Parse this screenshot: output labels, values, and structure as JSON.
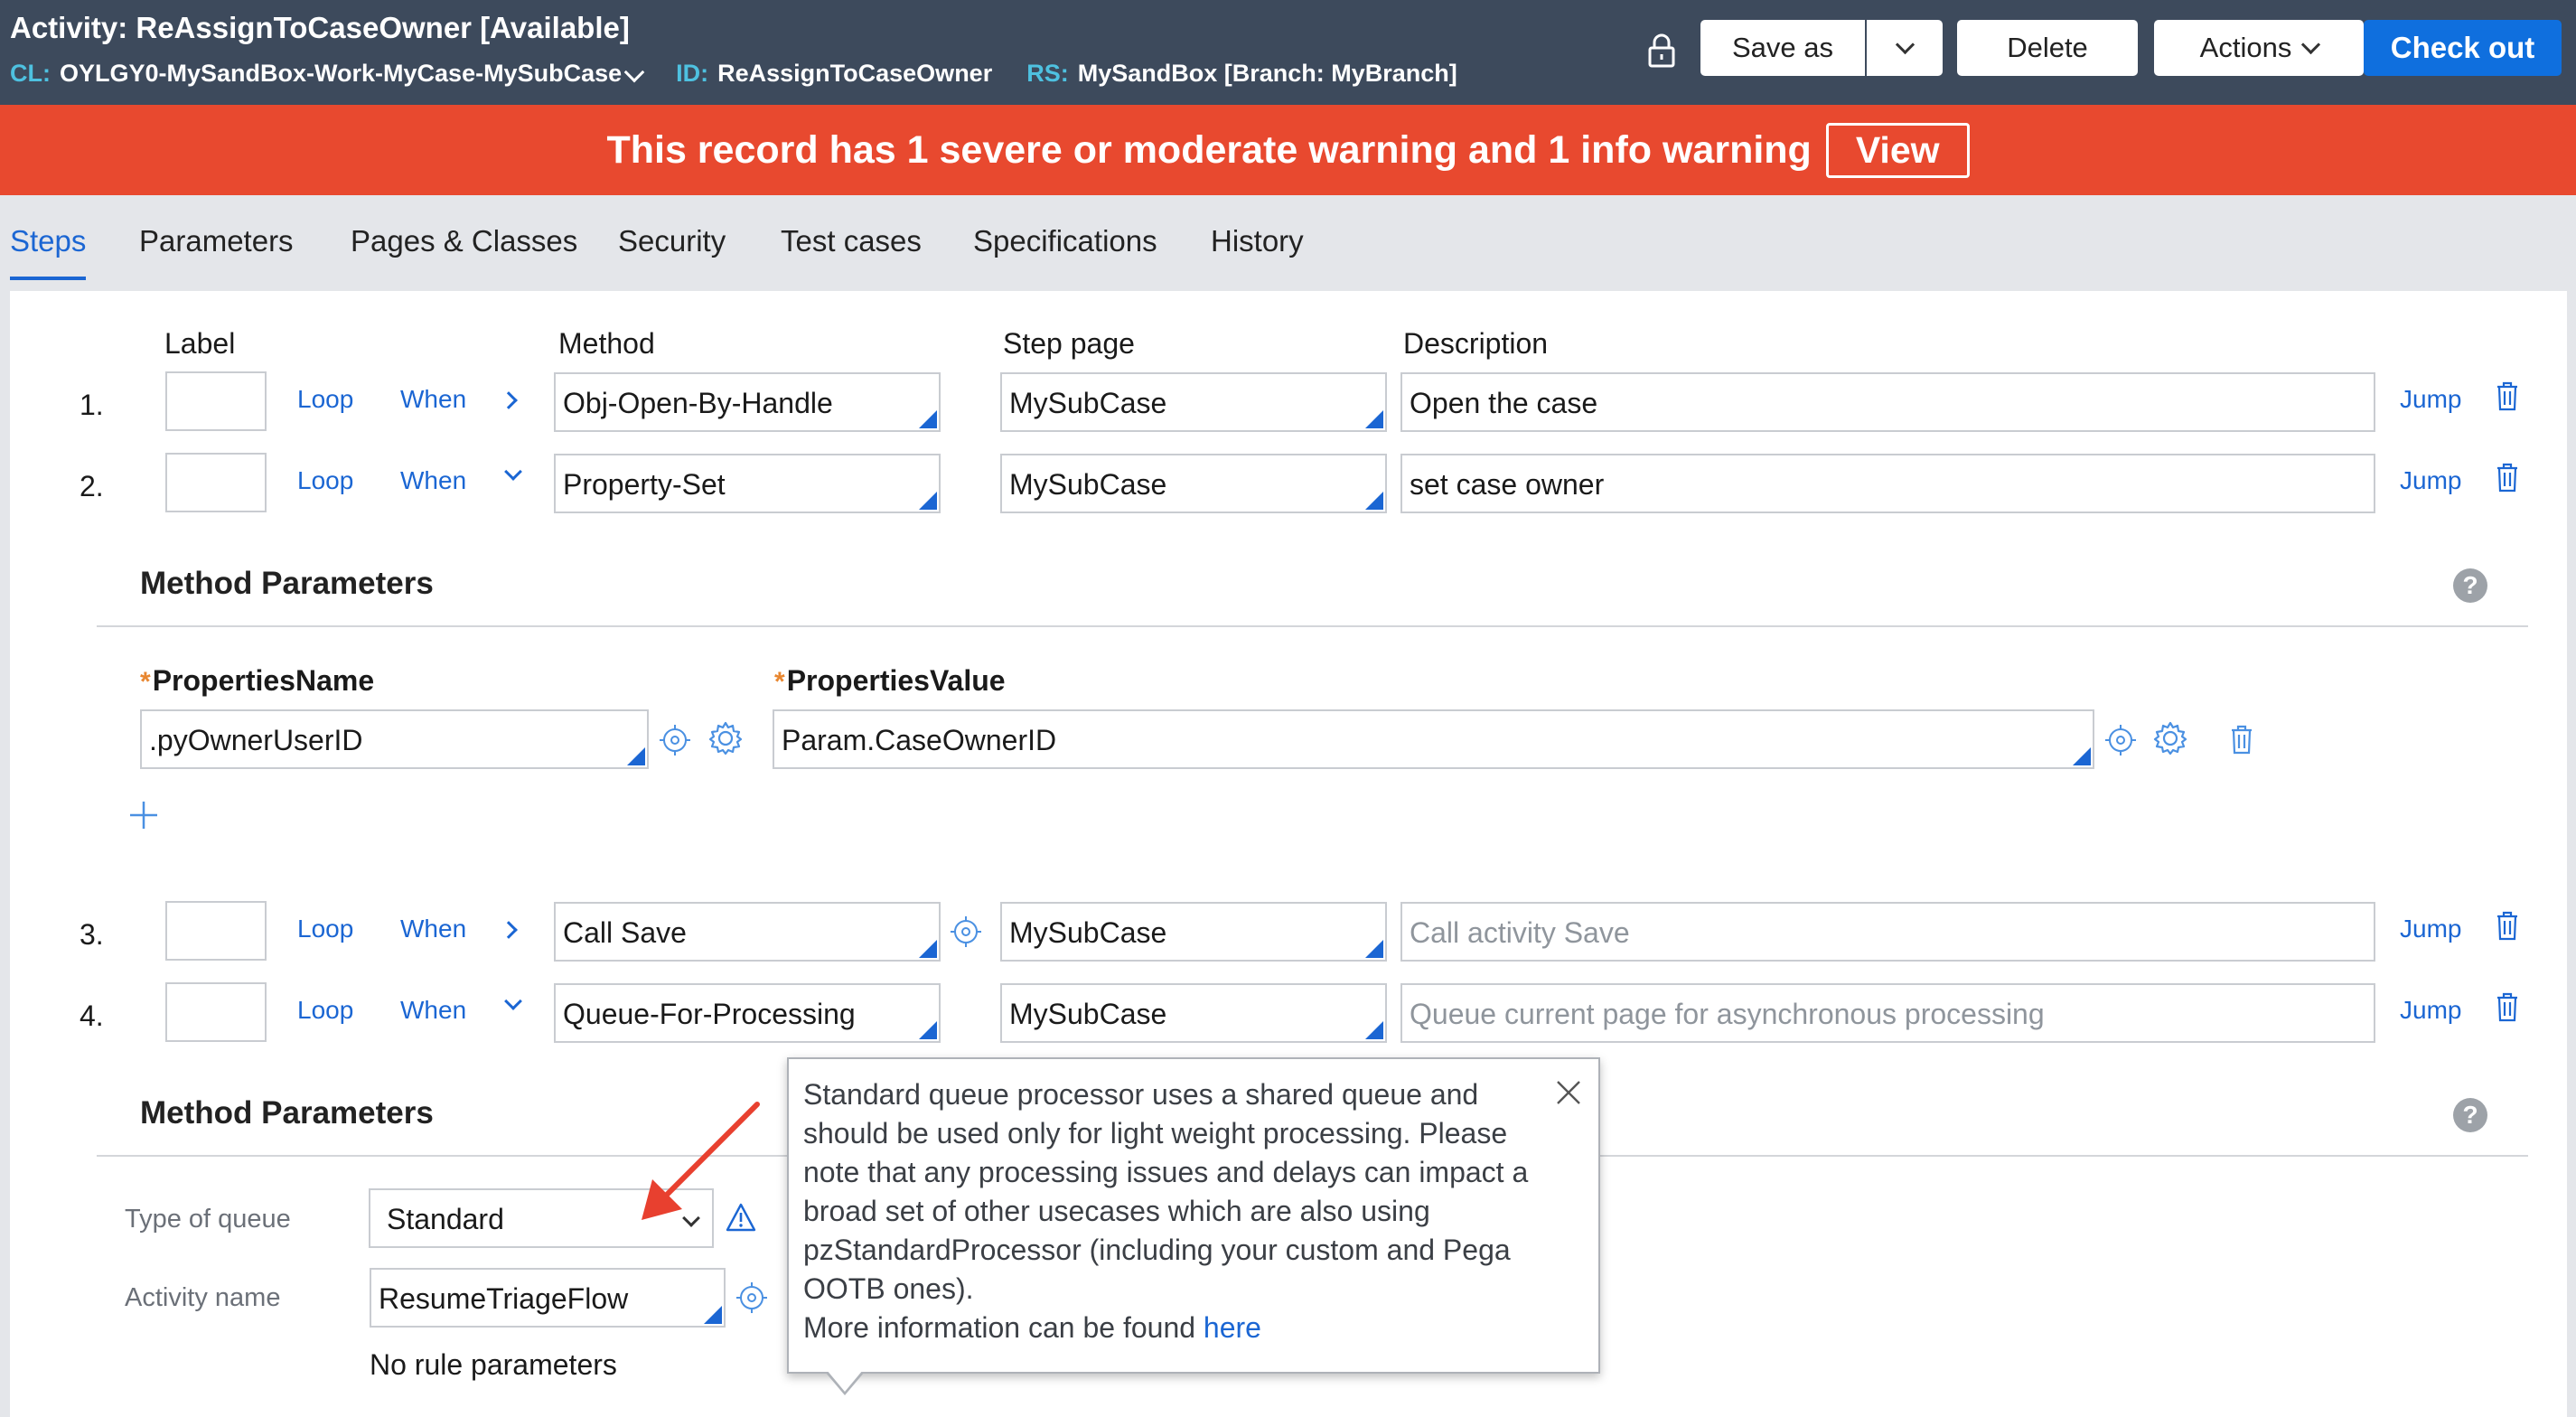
{
  "header": {
    "title": "Activity: ReAssignToCaseOwner [Available]",
    "cl_key": "CL:",
    "cl_value": "OYLGY0-MySandBox-Work-MyCase-MySubCase",
    "id_key": "ID:",
    "id_value": "ReAssignToCaseOwner",
    "rs_key": "RS:",
    "rs_value": "MySandBox [Branch: MyBranch]",
    "buttons": {
      "save_as": "Save as",
      "delete": "Delete",
      "actions": "Actions",
      "check_out": "Check out"
    }
  },
  "warning": {
    "text": "This record has 1 severe or moderate warning and 1 info warning",
    "view": "View"
  },
  "tabs": [
    "Steps",
    "Parameters",
    "Pages & Classes",
    "Security",
    "Test cases",
    "Specifications",
    "History"
  ],
  "columns": {
    "label": "Label",
    "method": "Method",
    "step_page": "Step page",
    "description": "Description"
  },
  "row_links": {
    "loop": "Loop",
    "when": "When",
    "jump": "Jump"
  },
  "steps": [
    {
      "num": "1.",
      "method": "Obj-Open-By-Handle",
      "step_page": "MySubCase",
      "description": "Open the case"
    },
    {
      "num": "2.",
      "method": "Property-Set",
      "step_page": "MySubCase",
      "description": "set case owner"
    },
    {
      "num": "3.",
      "method": "Call Save",
      "step_page": "MySubCase",
      "description_placeholder": "Call activity Save"
    },
    {
      "num": "4.",
      "method": "Queue-For-Processing",
      "step_page": "MySubCase",
      "description_placeholder": "Queue current page for asynchronous processing"
    }
  ],
  "method_params_title": "Method Parameters",
  "property_set": {
    "name_label": "PropertiesName",
    "value_label": "PropertiesValue",
    "name_value": ".pyOwnerUserID",
    "value_value": "Param.CaseOwnerID"
  },
  "queue": {
    "type_label": "Type of queue",
    "type_value": "Standard",
    "activity_label": "Activity name",
    "activity_value": "ResumeTriageFlow",
    "no_params": "No rule parameters"
  },
  "tooltip": {
    "text": "Standard queue processor uses a shared queue and should be used only for light weight processing. Please note that any processing issues and delays can impact a broad set of other usecases which are also using pzStandardProcessor (including your custom and Pega OOTB ones).",
    "more": "More information can be found",
    "link": "here"
  },
  "colors": {
    "header_bg": "#3d4a5c",
    "accent_cyan": "#4ec1e0",
    "warning_bg": "#e8492f",
    "primary_blue": "#0f6fde",
    "link_blue": "#1b66d3",
    "annotation_arrow": "#e8402f"
  },
  "icons": [
    "lock-icon",
    "chevron-down-icon",
    "trash-icon",
    "crosshair-icon",
    "gear-icon",
    "help-icon",
    "plus-icon",
    "warning-triangle-icon",
    "close-icon",
    "annotation-arrow"
  ]
}
